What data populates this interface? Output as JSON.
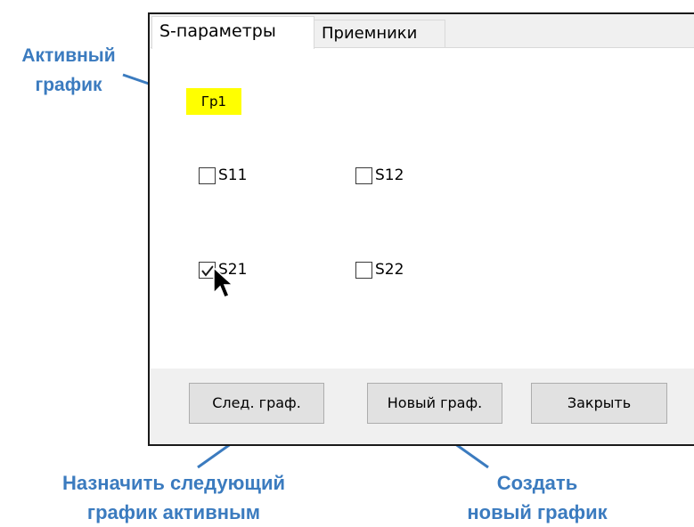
{
  "tabs": [
    {
      "label": "S-параметры",
      "active": true
    },
    {
      "label": "Приемники",
      "active": false
    }
  ],
  "active_graph": {
    "label": "Гр1",
    "highlight": "#ffff00"
  },
  "checkboxes": [
    {
      "label": "S11",
      "checked": false
    },
    {
      "label": "S12",
      "checked": false
    },
    {
      "label": "S21",
      "checked": true
    },
    {
      "label": "S22",
      "checked": false
    }
  ],
  "buttons": {
    "next_graph": "След. граф.",
    "new_graph": "Новый граф.",
    "close": "Закрыть"
  },
  "annotations": {
    "active_graph_line1": "Активный",
    "active_graph_line2": "график",
    "set_next_line1": "Назначить следующий",
    "set_next_line2": "график активным",
    "create_new_line1": "Создать",
    "create_new_line2": "новый график",
    "color": "#3b7bbf"
  }
}
